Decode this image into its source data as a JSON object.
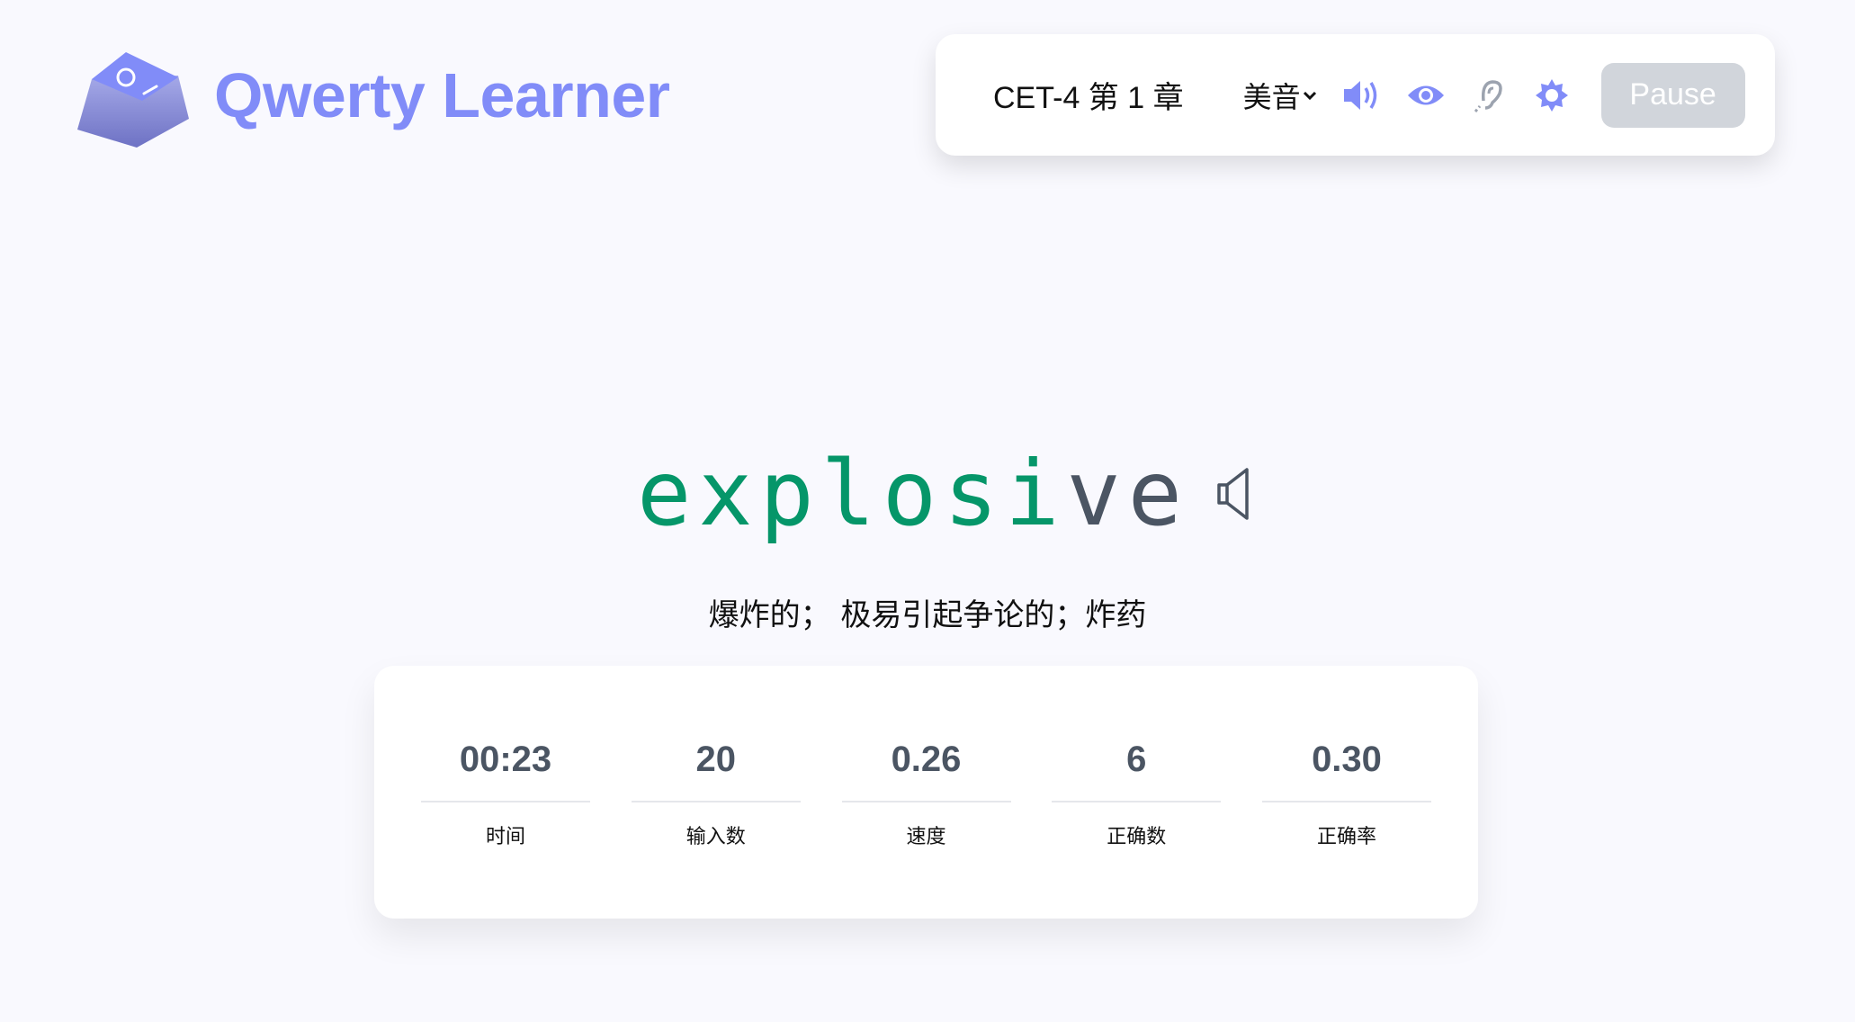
{
  "header": {
    "title": "Qwerty Learner",
    "logo_icon": "keycap-q-logo"
  },
  "toolbar": {
    "chapter": "CET-4 第 1 章",
    "accent": "美音",
    "icons": [
      "volume-icon",
      "eye-icon",
      "ear-icon",
      "sun-icon"
    ],
    "pause_label": "Pause",
    "accent_color": "#818cf8"
  },
  "word": {
    "typed": "explosi",
    "remaining": "ve",
    "typed_color": "#059669",
    "remaining_color": "#4b5563"
  },
  "translation": "爆炸的； 极易引起争论的；炸药",
  "stats": [
    {
      "value": "00:23",
      "label": "时间"
    },
    {
      "value": "20",
      "label": "输入数"
    },
    {
      "value": "0.26",
      "label": "速度"
    },
    {
      "value": "6",
      "label": "正确数"
    },
    {
      "value": "0.30",
      "label": "正确率"
    }
  ]
}
